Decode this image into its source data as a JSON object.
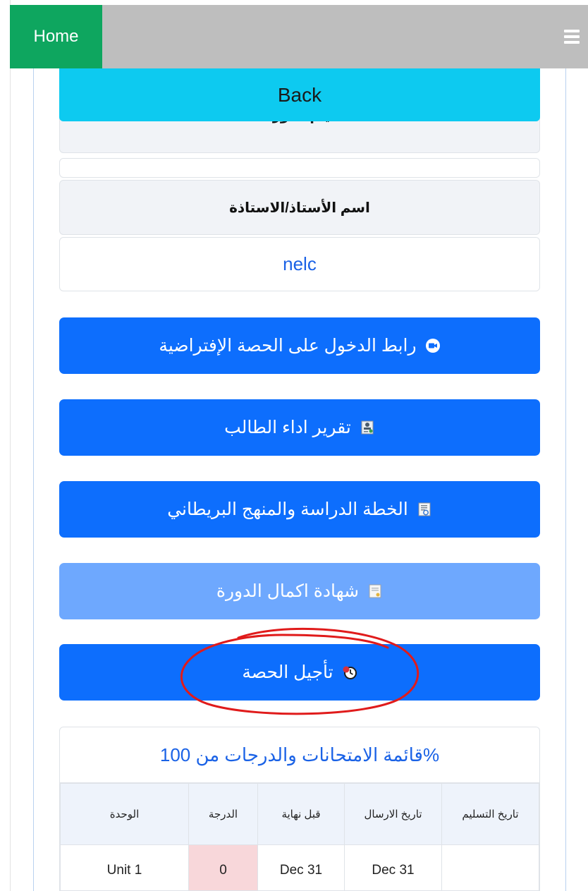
{
  "nav": {
    "home_label": "Home",
    "menu_icon": "hamburger-icon"
  },
  "back_label": "Back",
  "course": {
    "days_label": "أيام الدورة",
    "days_value": "",
    "teacher_label": "اسم الأستاذ/الاستاذة",
    "teacher_name": "nelc"
  },
  "buttons": [
    {
      "label": "رابط الدخول على الحصة الإفتراضية",
      "icon": "video-camera-icon"
    },
    {
      "label": "تقرير اداء الطالب",
      "icon": "report-icon"
    },
    {
      "label": "الخطة الدراسة والمنهج البريطاني",
      "icon": "curriculum-icon"
    },
    {
      "label": "شهادة اكمال الدورة",
      "icon": "certificate-icon"
    },
    {
      "label": "تأجيل الحصة",
      "icon": "clock-icon"
    }
  ],
  "exams": {
    "title": "قائمة الامتحانات والدرجات من 100%",
    "columns": [
      "الوحدة",
      "الدرجة",
      "قبل نهاية",
      "تاريخ الارسال",
      "تاريخ التسليم"
    ],
    "rows": [
      {
        "unit": "Unit 1",
        "grade": "0",
        "before_end": "Dec 31",
        "sent_date": "Dec 31",
        "delivery_date": ""
      }
    ]
  },
  "colors": {
    "primary": "#0d6efd",
    "info": "#0dcaf0",
    "success": "#0ea65f",
    "annotation": "#e01b1b"
  }
}
